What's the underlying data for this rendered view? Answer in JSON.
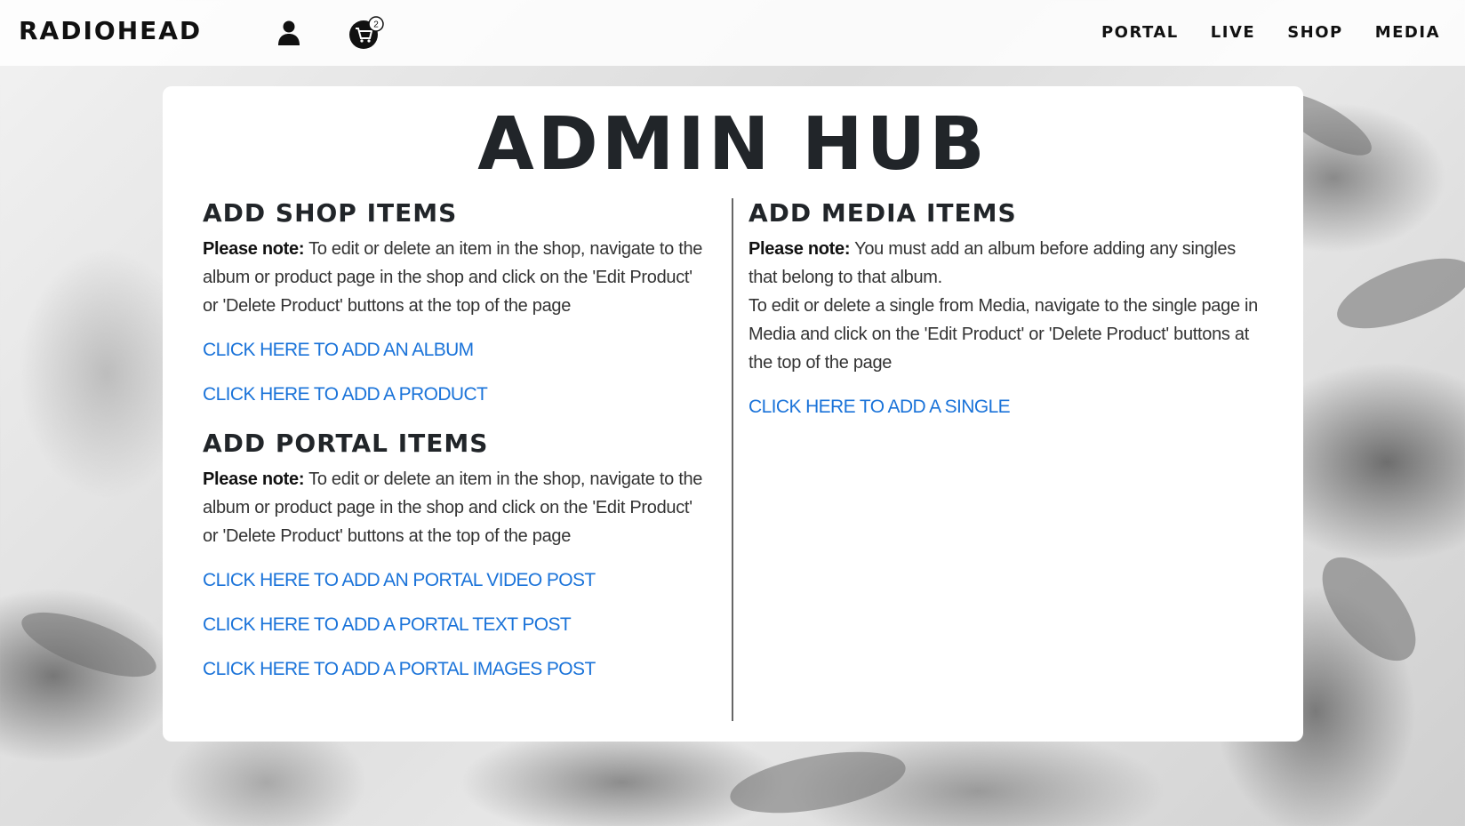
{
  "navbar": {
    "brand": "RADIOHEAD",
    "cart_count": "2",
    "links": [
      "PORTAL",
      "LIVE",
      "SHOP",
      "MEDIA"
    ]
  },
  "main": {
    "title": "ADMIN HUB",
    "shop": {
      "heading": "ADD SHOP ITEMS",
      "note_label": "Please note:",
      "note_text": " To edit or delete an item in the shop, navigate to the album or product page in the shop and click on the 'Edit Product' or 'Delete Product' buttons at the top of the page",
      "links": [
        "CLICK HERE TO ADD AN ALBUM",
        "CLICK HERE TO ADD A PRODUCT"
      ]
    },
    "portal": {
      "heading": "ADD PORTAL ITEMS",
      "note_label": "Please note:",
      "note_text": " To edit or delete an item in the shop, navigate to the album or product page in the shop and click on the 'Edit Product' or 'Delete Product' buttons at the top of the page",
      "links": [
        "CLICK HERE TO ADD AN PORTAL VIDEO POST",
        "CLICK HERE TO ADD A PORTAL TEXT POST",
        "CLICK HERE TO ADD A PORTAL IMAGES POST"
      ]
    },
    "media": {
      "heading": "ADD MEDIA ITEMS",
      "note_label": "Please note:",
      "note_text": " You must add an album before adding any singles that belong to that album.",
      "note_text_2": "To edit or delete a single from Media, navigate to the single page in Media and click on the 'Edit Product' or 'Delete Product' buttons at the top of the page",
      "links": [
        "CLICK HERE TO ADD A SINGLE"
      ]
    }
  },
  "colors": {
    "link": "#1a73d9",
    "text": "#212529"
  }
}
